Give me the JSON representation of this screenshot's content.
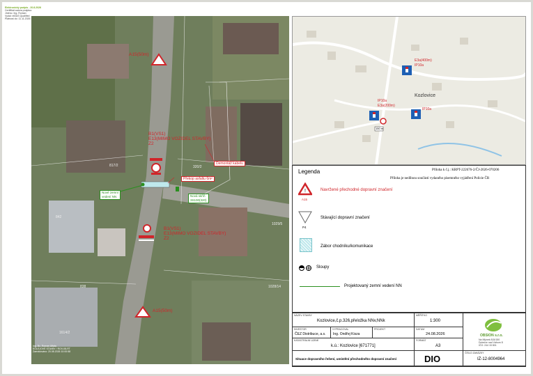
{
  "stamp": {
    "lines": [
      "Elektronický podpis - 20.8.2026",
      "Certifikát autora podpisu:",
      "Jméno: Ing. Roman",
      "Vydal: eIDAS Qualified",
      "Platnost do: 11.11.2026 13:00:00"
    ]
  },
  "aerial": {
    "sign_labels": [
      {
        "text": "A15(50m)"
      },
      {
        "text": "A15(50m)"
      }
    ],
    "red_text_top": [
      "B1(VS1)",
      "E13(MIMO VOZIDEL STAVBY)",
      "Z2"
    ],
    "red_text_bottom": [
      "B1(VS1)",
      "E13(MIMO VOZIDEL STAVBY)",
      "Z2"
    ],
    "box_demontaz": "Demontáž kabelu",
    "box_prekop": "Překop asfaltu 6m²",
    "box_nove_vedeni": [
      "Nové zemní",
      "vedení NN"
    ],
    "box_nova_skrin": [
      "Nová skříň",
      "3S100(320)"
    ],
    "parcels": [
      "817/2",
      "320/2",
      "842",
      "838",
      "1028/14",
      "1029/5",
      "1614/2"
    ],
    "corner_lines": [
      "Ing. Bc. Roman Aftala",
      "KOLEJOVÉ STAVBY / ROV-08-RT",
      "Zaevidováno: 20.08.2026 10:00:58"
    ]
  },
  "map": {
    "town": "Kozlovice",
    "labels": [
      "E3a(400m)",
      "IP10a",
      "IP10a",
      "E3a(200m)",
      "IP10a",
      "150 m"
    ]
  },
  "legend": {
    "title": "Legenda",
    "header_note": "Příloha k č.j.: KRPT-222676-2/ČJ-2026-070206",
    "header_note2": "Příloha je nedílnou součástí vydaného písemného vyjádření Policie ČR",
    "items": [
      {
        "label": "Navržené přechodné dopravní značení",
        "code": "A15"
      },
      {
        "label": "Stávající dopravní značení",
        "code": "P4"
      },
      {
        "label": "Zábor chodníku/komunikace"
      },
      {
        "label": "Sloupy"
      },
      {
        "label": "Projektovaný zemní vedení NN"
      }
    ]
  },
  "titleblock": {
    "caps": {
      "name": "NÁZEV STAVBY",
      "scale": "MĚŘÍTKO",
      "investor": "INVESTOR",
      "author": "VYPRACOVAL",
      "check": "PROJEKT",
      "date": "DATUM",
      "cadastre": "KATASTRÁLNÍ ÚZEMÍ",
      "format": "FORMÁT",
      "number": "ČÍSLO ZAKÁZKY"
    },
    "name": "Kozlovice,č.p.326,přeložka NNv,NNk",
    "scale": "1:300",
    "investor": "ČEZ Distribuce, a.s.",
    "author": "Ing. Ondřej Kisza",
    "date": "24.08.2026",
    "cadastre": "k.ú.: Kozlovice [671771]",
    "format": "A3",
    "description": "Situace dopravního řešení, umístění přechodného dopravní značení",
    "code": "DIO",
    "number": "IZ-12-8004964",
    "company": "OBSION s.r.o.",
    "company_address": [
      "Na Mlýnek 815/150",
      "Dubnice nad Váhom 8",
      "IČO: 244 15 801"
    ]
  },
  "colors": {
    "red": "#d0252a",
    "green": "#2a8f1f",
    "sign_blue": "#1d5fb4"
  }
}
